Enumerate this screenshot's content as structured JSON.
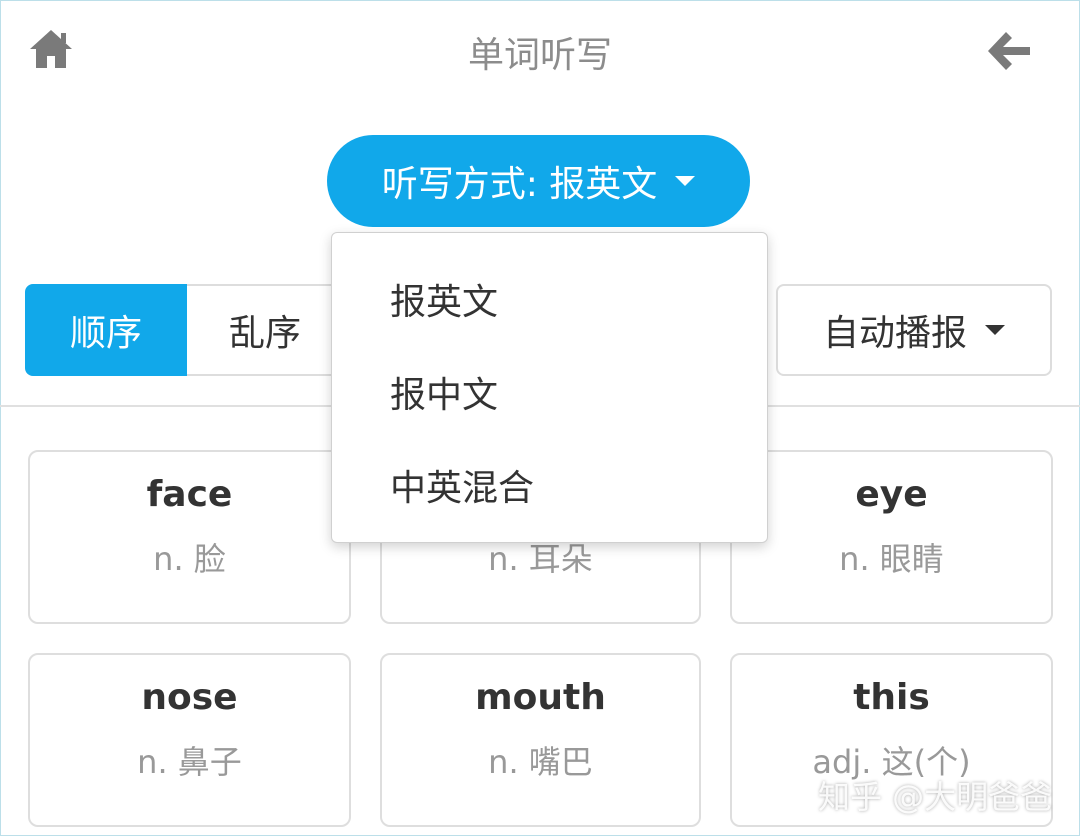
{
  "header": {
    "title": "单词听写",
    "home_icon": "home-icon",
    "back_icon": "arrow-left-icon",
    "icon_color": "#7a7a7a"
  },
  "mode": {
    "label": "听写方式: 报英文"
  },
  "order": {
    "options": [
      "顺序",
      "乱序"
    ],
    "selected": "顺序"
  },
  "playback": {
    "label": "自动播报"
  },
  "dropdown": {
    "options": [
      "报英文",
      "报中文",
      "中英混合"
    ]
  },
  "words": [
    {
      "en": "face",
      "cn": "n. 脸"
    },
    {
      "en": "",
      "cn": "n. 耳朵"
    },
    {
      "en": "eye",
      "cn": "n. 眼睛"
    },
    {
      "en": "nose",
      "cn": "n. 鼻子"
    },
    {
      "en": "mouth",
      "cn": "n. 嘴巴"
    },
    {
      "en": "this",
      "cn": "adj. 这(个)"
    }
  ],
  "watermark": "知乎 @大明爸爸",
  "colors": {
    "accent": "#11a8ea"
  }
}
